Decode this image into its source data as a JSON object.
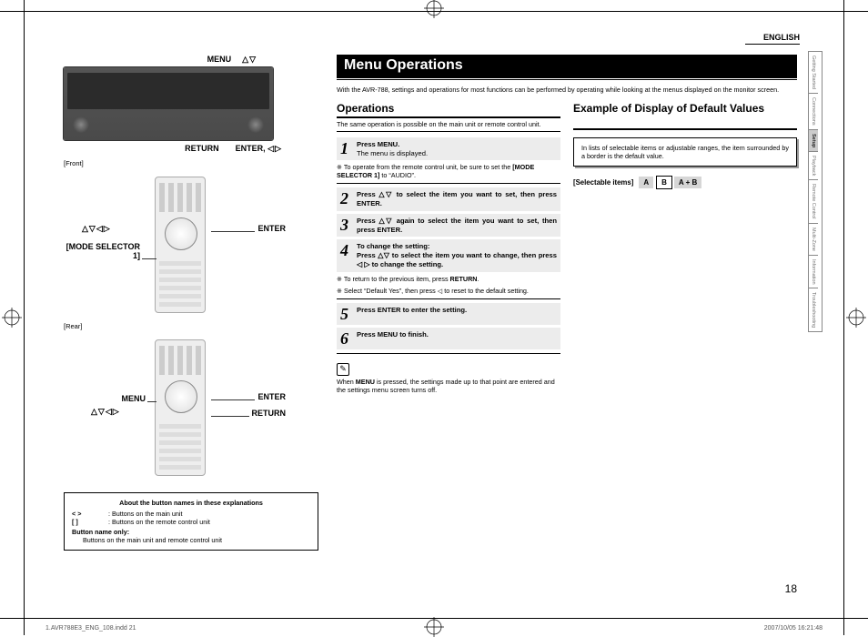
{
  "header": {
    "language": "ENGLISH"
  },
  "side_tabs": [
    {
      "label": "Getting Started",
      "active": false
    },
    {
      "label": "Connections",
      "active": false
    },
    {
      "label": "Setup",
      "active": true
    },
    {
      "label": "Playback",
      "active": false
    },
    {
      "label": "Remote Control",
      "active": false
    },
    {
      "label": "Multi-Zone",
      "active": false
    },
    {
      "label": "Information",
      "active": false
    },
    {
      "label": "Troubleshooting",
      "active": false
    }
  ],
  "left": {
    "top_callouts": {
      "menu": "MENU",
      "menu_arrows": "△▽",
      "return": "RETURN",
      "enter": "ENTER,",
      "enter_arrows": "◁▷"
    },
    "front_label": "[Front]",
    "rear_label": "[Rear]",
    "enter_label": "ENTER",
    "mode_selector": "[MODE SELECTOR 1]",
    "arrows4": "△▽◁▷",
    "menu_label": "MENU",
    "return_label": "RETURN",
    "legend": {
      "title": "About the button names in these explanations",
      "row1_sym": "<    >",
      "row1_text": ": Buttons on the main unit",
      "row2_sym": "[    ]",
      "row2_text": ": Buttons on the remote control unit",
      "row3_label": "Button name only:",
      "row3_text": "Buttons on the main unit and remote control unit"
    }
  },
  "main": {
    "title": "Menu Operations",
    "intro": "With the AVR-788, settings and operations for most functions can be performed by operating while looking at the menus displayed on the monitor screen.",
    "operations_title": "Operations",
    "operations_sub": "The same operation is possible on the main unit or remote control unit.",
    "steps": [
      {
        "n": "1",
        "html": "<b>Press MENU.</b><br>The menu is displayed."
      },
      {
        "n": "note",
        "html": "To operate from the remote control unit, be sure to set the <b>[MODE SELECTOR 1]</b> to “AUDIO”."
      },
      {
        "n": "2",
        "html": "<b>Press <span class='tri-inline'>△▽</span> to select the item you want to set, then press ENTER.</b>"
      },
      {
        "n": "3",
        "html": "<b>Press <span class='tri-inline'>△▽</span> again to select the item you want to set, then press ENTER.</b>"
      },
      {
        "n": "4",
        "html": "<b>To change the setting:</b><br><b>Press <span class='tri-inline'>△▽</span> to select the item you want to change, then press <span class='tri-inline'>◁ ▷</span> to change the setting.</b>"
      },
      {
        "n": "note",
        "html": "To return to the previous item, press <b>RETURN</b>."
      },
      {
        "n": "note2",
        "html": "Select “Default Yes”, then press ◁ to reset to the default setting."
      },
      {
        "n": "5",
        "html": "<b>Press ENTER to enter the setting.</b>"
      },
      {
        "n": "6",
        "html": "<b>Press MENU to finish.</b>"
      }
    ],
    "footnote": "When <b>MENU</b> is pressed, the settings made up to that point are entered and the settings menu screen turns off.",
    "example_title": "Example of Display of Default Values",
    "example_body": "In lists of selectable items or adjustable ranges, the item surrounded by a border is the default value.",
    "selectable_label": "[Selectable items]",
    "chips": {
      "a": "A",
      "b": "B",
      "ab": "A + B"
    }
  },
  "page_number": "18",
  "footer": {
    "left": "1.AVR788E3_ENG_108.indd   21",
    "right": "2007/10/05   16:21:48"
  }
}
